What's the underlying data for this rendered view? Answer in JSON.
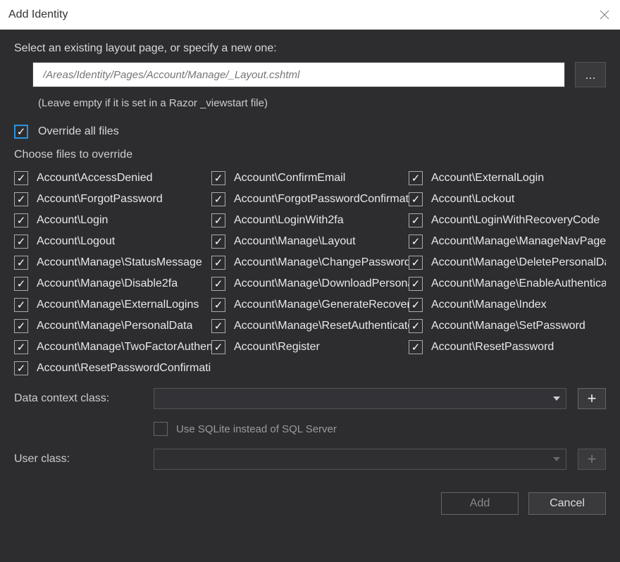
{
  "title": "Add Identity",
  "layoutPrompt": "Select an existing layout page, or specify a new one:",
  "layoutPlaceholder": "/Areas/Identity/Pages/Account/Manage/_Layout.cshtml",
  "browseLabel": "...",
  "layoutHint": "(Leave empty if it is set in a Razor _viewstart file)",
  "overrideAll": {
    "label": "Override all files",
    "checked": true
  },
  "chooseLabel": "Choose files to override",
  "files": [
    {
      "label": "Account\\AccessDenied",
      "checked": true
    },
    {
      "label": "Account\\ConfirmEmail",
      "checked": true
    },
    {
      "label": "Account\\ExternalLogin",
      "checked": true
    },
    {
      "label": "Account\\ForgotPassword",
      "checked": true
    },
    {
      "label": "Account\\ForgotPasswordConfirmation",
      "checked": true
    },
    {
      "label": "Account\\Lockout",
      "checked": true
    },
    {
      "label": "Account\\Login",
      "checked": true
    },
    {
      "label": "Account\\LoginWith2fa",
      "checked": true
    },
    {
      "label": "Account\\LoginWithRecoveryCode",
      "checked": true
    },
    {
      "label": "Account\\Logout",
      "checked": true
    },
    {
      "label": "Account\\Manage\\Layout",
      "checked": true
    },
    {
      "label": "Account\\Manage\\ManageNavPages",
      "checked": true
    },
    {
      "label": "Account\\Manage\\StatusMessage",
      "checked": true
    },
    {
      "label": "Account\\Manage\\ChangePassword",
      "checked": true
    },
    {
      "label": "Account\\Manage\\DeletePersonalData",
      "checked": true
    },
    {
      "label": "Account\\Manage\\Disable2fa",
      "checked": true
    },
    {
      "label": "Account\\Manage\\DownloadPersonalData",
      "checked": true
    },
    {
      "label": "Account\\Manage\\EnableAuthenticator",
      "checked": true
    },
    {
      "label": "Account\\Manage\\ExternalLogins",
      "checked": true
    },
    {
      "label": "Account\\Manage\\GenerateRecoveryCodes",
      "checked": true
    },
    {
      "label": "Account\\Manage\\Index",
      "checked": true
    },
    {
      "label": "Account\\Manage\\PersonalData",
      "checked": true
    },
    {
      "label": "Account\\Manage\\ResetAuthenticator",
      "checked": true
    },
    {
      "label": "Account\\Manage\\SetPassword",
      "checked": true
    },
    {
      "label": "Account\\Manage\\TwoFactorAuthentication",
      "checked": true
    },
    {
      "label": "Account\\Register",
      "checked": true
    },
    {
      "label": "Account\\ResetPassword",
      "checked": true
    },
    {
      "label": "Account\\ResetPasswordConfirmation",
      "checked": true
    }
  ],
  "dataContextLabel": "Data context class:",
  "sqliteLabel": "Use SQLite instead of SQL Server",
  "sqliteChecked": false,
  "userClassLabel": "User class:",
  "addLabel": "Add",
  "cancelLabel": "Cancel",
  "plus": "+"
}
